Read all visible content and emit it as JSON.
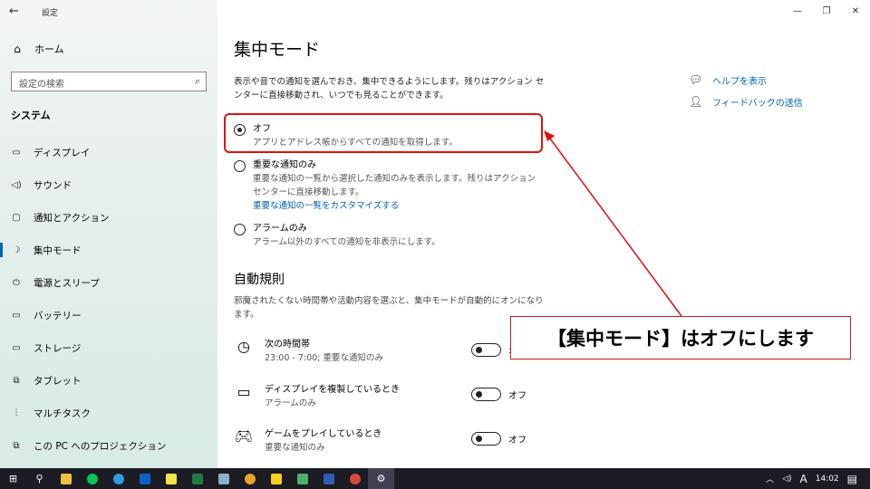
{
  "window": {
    "app_title": "設定",
    "minimize": "—",
    "restore": "❐",
    "close": "✕",
    "back": "←"
  },
  "sidebar": {
    "home_label": "ホーム",
    "search_placeholder": "設定の検索",
    "section_title": "システム",
    "items": [
      {
        "label": "ディスプレイ",
        "icon": "display-icon",
        "glyph": "▭"
      },
      {
        "label": "サウンド",
        "icon": "speaker-icon",
        "glyph": "◁)"
      },
      {
        "label": "通知とアクション",
        "icon": "notification-icon",
        "glyph": "▢"
      },
      {
        "label": "集中モード",
        "icon": "moon-icon",
        "glyph": "☽"
      },
      {
        "label": "電源とスリープ",
        "icon": "power-icon",
        "glyph": "⏻"
      },
      {
        "label": "バッテリー",
        "icon": "battery-icon",
        "glyph": "▭"
      },
      {
        "label": "ストレージ",
        "icon": "storage-icon",
        "glyph": "▭"
      },
      {
        "label": "タブレット",
        "icon": "tablet-icon",
        "glyph": "⧉"
      },
      {
        "label": "マルチタスク",
        "icon": "multitask-icon",
        "glyph": "⫶"
      },
      {
        "label": "この PC へのプロジェクション",
        "icon": "projection-icon",
        "glyph": "⧉"
      }
    ],
    "active_index": 3
  },
  "main": {
    "title": "集中モード",
    "description": "表示や音での通知を選んでおき、集中できるようにします。残りはアクション センターに直接移動され、いつでも見ることができます。",
    "options": [
      {
        "label": "オフ",
        "sub": "アプリとアドレス帳からすべての通知を取得します。",
        "link": "",
        "selected": true
      },
      {
        "label": "重要な通知のみ",
        "sub": "重要な通知の一覧から選択した通知のみを表示します。残りはアクション センターに直接移動します。",
        "link": "重要な通知の一覧をカスタマイズする",
        "selected": false
      },
      {
        "label": "アラームのみ",
        "sub": "アラーム以外のすべての通知を非表示にします。",
        "link": "",
        "selected": false
      }
    ],
    "auto_rules_title": "自動規則",
    "auto_rules_desc": "邪魔されたくない時間帯や活動内容を選ぶと、集中モードが自動的にオンになります。",
    "rules": [
      {
        "title": "次の時間帯",
        "sub": "23:00 - 7:00; 重要な通知のみ",
        "state": "オフ",
        "icon": "clock-icon"
      },
      {
        "title": "ディスプレイを複製しているとき",
        "sub": "アラームのみ",
        "state": "オフ",
        "icon": "monitor-icon"
      },
      {
        "title": "ゲームをプレイしているとき",
        "sub": "重要な通知のみ",
        "state": "オフ",
        "icon": "gamepad-icon"
      }
    ],
    "help_link": "ヘルプを表示",
    "feedback_link": "フィードバックの送信"
  },
  "annotation": {
    "text": "【集中モード】はオフにします",
    "color": "#e01010"
  },
  "taskbar": {
    "apps": [
      "start",
      "search",
      "explorer",
      "line",
      "edge",
      "outlook",
      "sticky",
      "excel",
      "notepad",
      "chrome",
      "notes",
      "photos",
      "word",
      "chrome2",
      "settings"
    ],
    "time": "14:02",
    "ime": "A"
  }
}
